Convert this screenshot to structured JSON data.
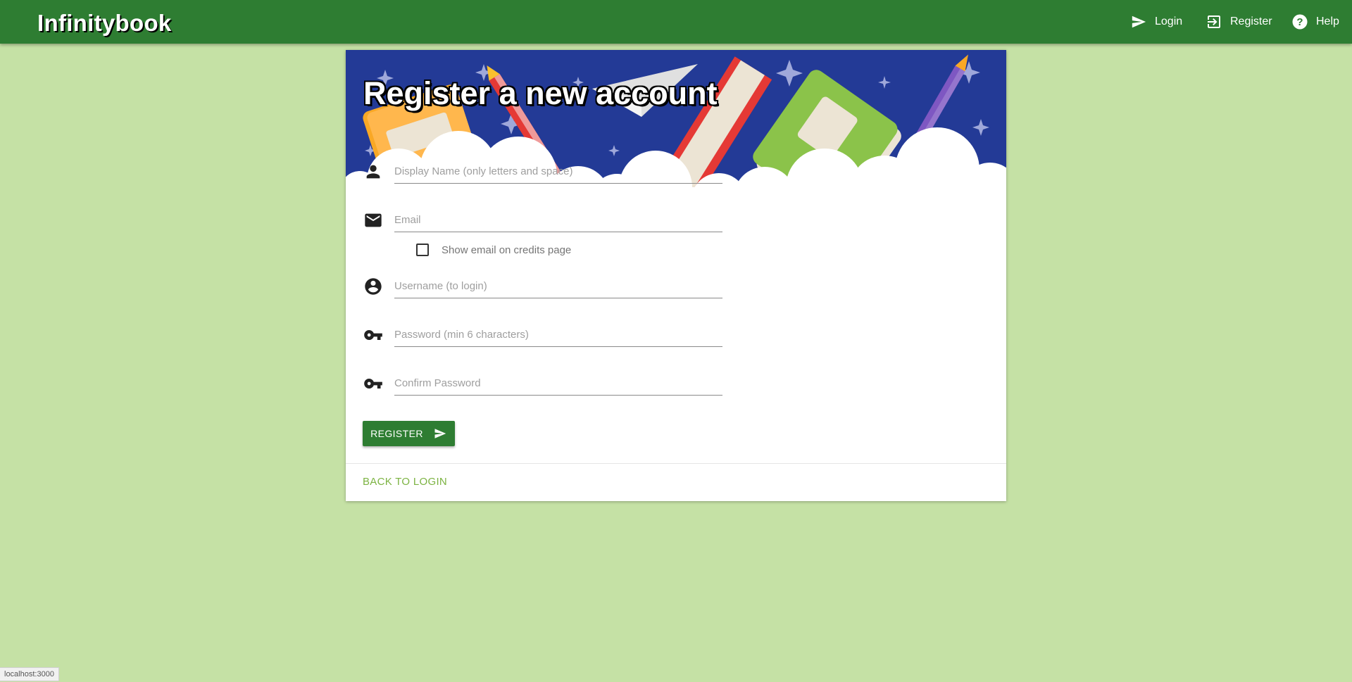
{
  "appbar": {
    "brand": "Infinitybook",
    "nav": {
      "login": "Login",
      "register": "Register",
      "help": "Help"
    }
  },
  "card": {
    "title": "Register a new account",
    "fields": {
      "display_name": {
        "placeholder": "Display Name (only letters and space)",
        "value": "",
        "icon": "person-icon"
      },
      "email": {
        "placeholder": "Email",
        "value": "",
        "icon": "mail-icon"
      },
      "username": {
        "placeholder": "Username (to login)",
        "value": "",
        "icon": "account-circle-icon"
      },
      "password": {
        "placeholder": "Password (min 6 characters)",
        "value": "",
        "icon": "key-icon"
      },
      "confirm_password": {
        "placeholder": "Confirm Password",
        "value": "",
        "icon": "key-icon"
      }
    },
    "show_email_checkbox": {
      "label": "Show email on credits page",
      "checked": false
    },
    "register_button": "REGISTER",
    "back_link": "BACK TO LOGIN"
  },
  "status_bar": "localhost:3000",
  "colors": {
    "background": "#c5e1a5",
    "appbar": "#2e7d32",
    "banner": "#233a96",
    "accent_link": "#7cb342"
  }
}
